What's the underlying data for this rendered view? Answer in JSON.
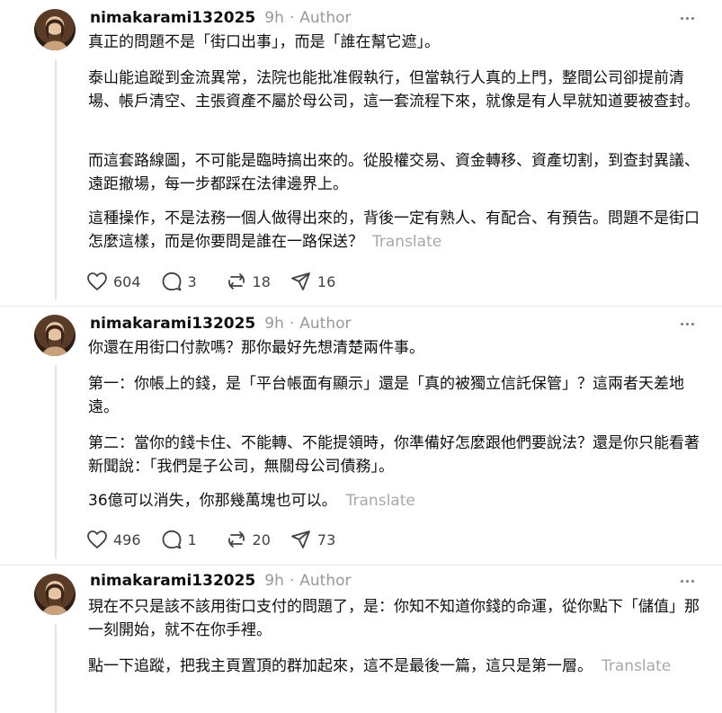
{
  "posts": [
    {
      "username": "nimakarami132025",
      "time": "9h",
      "sep": "·",
      "author_label": "Author",
      "paragraphs": [
        "真正的問題不是「街口出事」，而是「誰在幫它遮」。",
        "泰山能追蹤到金流異常，法院也能批准假執行，但當執行人真的上門，整間公司卻提前清場、帳戶清空、主張資產不屬於母公司，這一套流程下來，就像是有人早就知道要被查封。",
        "而這套路線圖，不可能是臨時搞出來的。從股權交易、資金轉移、資產切割，到查封異議、遠距撤場，每一步都踩在法律邊界上。",
        "這種操作，不是法務一個人做得出來的，背後一定有熟人、有配合、有預告。問題不是街口怎麼這樣，而是你要問是誰在一路保送？"
      ],
      "translate_label": "Translate",
      "likes": "604",
      "replies": "3",
      "reposts": "18",
      "shares": "16"
    },
    {
      "username": "nimakarami132025",
      "time": "9h",
      "sep": "·",
      "author_label": "Author",
      "paragraphs": [
        "你還在用街口付款嗎？那你最好先想清楚兩件事。",
        "第一：你帳上的錢，是「平台帳面有顯示」還是「真的被獨立信託保管」？這兩者天差地遠。",
        "第二：當你的錢卡住、不能轉、不能提領時，你準備好怎麼跟他們要說法？還是你只能看著新聞說：「我們是子公司，無關母公司債務」。",
        "36億可以消失，你那幾萬塊也可以。"
      ],
      "translate_label": "Translate",
      "likes": "496",
      "replies": "1",
      "reposts": "20",
      "shares": "73"
    },
    {
      "username": "nimakarami132025",
      "time": "9h",
      "sep": "·",
      "author_label": "Author",
      "paragraphs": [
        "現在不只是該不該用街口支付的問題了，是：你知不知道你錢的命運，從你點下「儲值」那一刻開始，就不在你手裡。",
        "點一下追蹤，把我主頁置頂的群加起來，這不是最後一篇，這只是第一層。"
      ],
      "translate_label": "Translate"
    }
  ],
  "icons": {
    "like": "heart-icon",
    "reply": "comment-icon",
    "repost": "repost-icon",
    "share": "send-icon",
    "more": "more-icon"
  }
}
